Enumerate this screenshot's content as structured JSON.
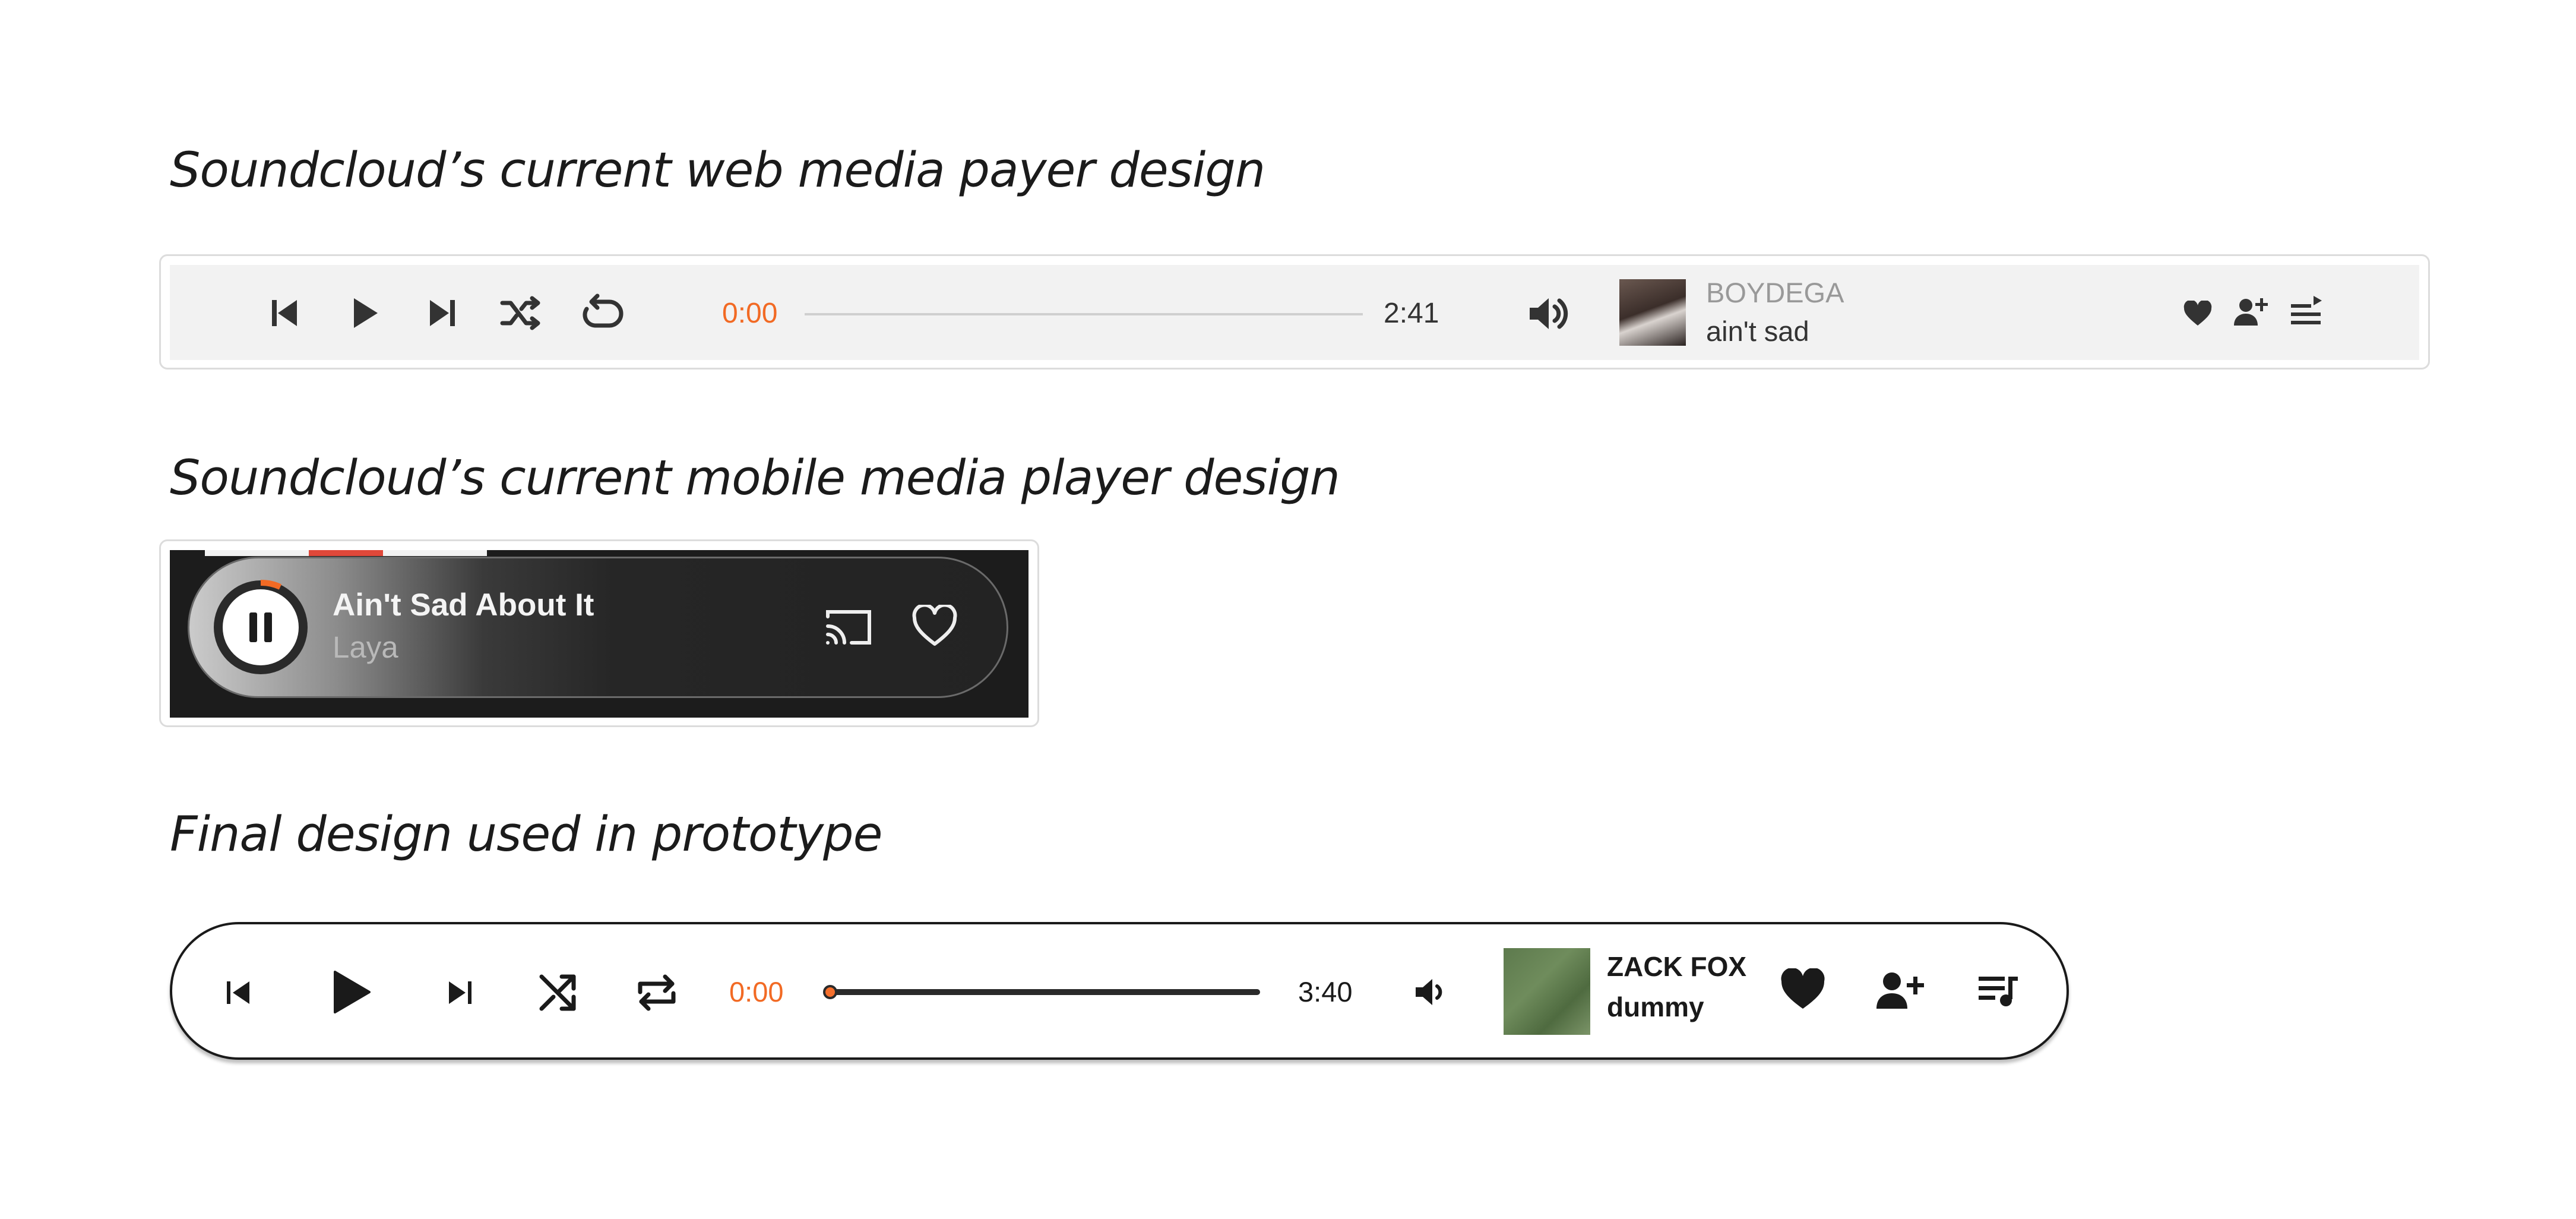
{
  "headings": {
    "web": "Soundcloud’s current web media payer design",
    "mobile": "Soundcloud’s current mobile media player design",
    "final": "Final design used in prototype"
  },
  "web_player": {
    "current_time": "0:00",
    "duration": "2:41",
    "progress": 0,
    "artist": "BOYDEGA",
    "title": "ain't sad",
    "icons": [
      "skip-back-icon",
      "play-icon",
      "skip-forward-icon",
      "shuffle-icon",
      "repeat-icon",
      "volume-icon",
      "heart-icon",
      "follow-icon",
      "queue-icon"
    ],
    "accent_color": "#f26a24"
  },
  "mobile_player": {
    "title": "Ain't Sad About It",
    "artist": "Laya",
    "icons": [
      "pause-icon",
      "cast-icon",
      "heart-icon"
    ]
  },
  "final_player": {
    "current_time": "0:00",
    "duration": "3:40",
    "progress": 0,
    "artist": "ZACK FOX",
    "title": "dummy",
    "icons": [
      "skip-back-icon",
      "play-icon",
      "skip-forward-icon",
      "shuffle-icon",
      "repeat-icon",
      "volume-icon",
      "heart-icon",
      "follow-icon",
      "queue-icon"
    ],
    "accent_color": "#f26a24"
  }
}
